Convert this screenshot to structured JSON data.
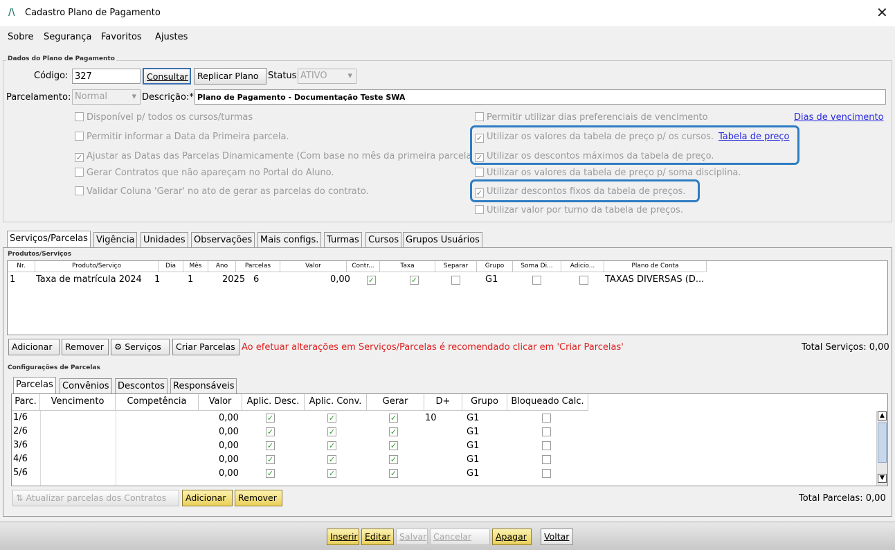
{
  "window": {
    "title": "Cadastro Plano de Pagamento",
    "logo": "/\\",
    "close": "✕"
  },
  "menu": [
    "Sobre",
    "Segurança",
    "Favoritos",
    "Ajustes"
  ],
  "plano": {
    "legend": "Dados do Plano de Pagamento",
    "codigo_label": "Código:",
    "codigo_value": "327",
    "consultar": "Consultar",
    "replicar": "Replicar Plano",
    "status_label": "Status:",
    "status_value": "ATIVO",
    "parcelamento_label": "Parcelamento:",
    "parcelamento_value": "Normal",
    "descricao_label": "Descrição:*",
    "descricao_value": "Plano de Pagamento - Documentação Teste SWA"
  },
  "options_left": [
    {
      "label": "Disponível p/ todos os cursos/turmas",
      "checked": false
    },
    {
      "label": "Permitir informar a Data da Primeira parcela.",
      "checked": false
    },
    {
      "label": "Ajustar as Datas das Parcelas Dinamicamente (Com base no mês da primeira parcela",
      "checked": true
    },
    {
      "label": "Gerar Contratos que não apareçam no Portal do Aluno.",
      "checked": false
    },
    {
      "label": "Validar Coluna 'Gerar' no ato de gerar as parcelas do contrato.",
      "checked": false
    }
  ],
  "options_right": [
    {
      "label": "Permitir utilizar dias preferenciais de vencimento",
      "checked": false
    },
    {
      "label": "Utilizar os valores da tabela de preço p/ os cursos.",
      "checked": true
    },
    {
      "label": "Utilizar os descontos máximos da tabela de preço.",
      "checked": true
    },
    {
      "label": "Utilizar os valores da tabela de preço p/ soma disciplina.",
      "checked": false
    },
    {
      "label": "Utilizar descontos fixos da tabela de preços.",
      "checked": true
    },
    {
      "label": "Utilizar valor por turno da tabela de preços.",
      "checked": false
    }
  ],
  "links": {
    "dias": "Dias de vencimento",
    "tabela": "Tabela de preço"
  },
  "tabs": [
    "Serviços/Parcelas",
    "Vigência",
    "Unidades",
    "Observações",
    "Mais configs.",
    "Turmas",
    "Cursos",
    "Grupos Usuários"
  ],
  "produtos": {
    "legend": "Produtos/Serviços",
    "headers": [
      "Nr.",
      "Produto/Serviço",
      "Dia",
      "Mês",
      "Ano",
      "Parcelas",
      "Valor",
      "Contr...",
      "Taxa",
      "Separar",
      "Grupo",
      "Soma Di...",
      "Adicio...",
      "Plano de Conta"
    ],
    "row": {
      "nr": "1",
      "produto": "Taxa de matrícula 2024",
      "dia": "1",
      "mes": "1",
      "ano": "2025",
      "parcelas": "6",
      "valor": "0,00",
      "grupo": "G1",
      "plano": "TAXAS DIVERSAS (D..."
    },
    "adicionar": "Adicionar",
    "remover": "Remover",
    "servicos": "Serviços",
    "criar": "Criar Parcelas",
    "aviso": "Ao efetuar alterações em Serviços/Parcelas é recomendado clicar em 'Criar Parcelas'",
    "total": "Total Serviços: 0,00"
  },
  "config": {
    "legend": "Configurações de Parcelas",
    "tabs": [
      "Parcelas",
      "Convênios",
      "Descontos",
      "Responsáveis"
    ],
    "headers": [
      "Parc.",
      "Vencimento",
      "Competência",
      "Valor",
      "Aplic. Desc.",
      "Aplic. Conv.",
      "Gerar",
      "D+",
      "Grupo",
      "Bloqueado Calc."
    ],
    "rows": [
      {
        "parc": "1/6",
        "valor": "0,00",
        "d": "10",
        "grupo": "G1"
      },
      {
        "parc": "2/6",
        "valor": "0,00",
        "d": "",
        "grupo": "G1"
      },
      {
        "parc": "3/6",
        "valor": "0,00",
        "d": "",
        "grupo": "G1"
      },
      {
        "parc": "4/6",
        "valor": "0,00",
        "d": "",
        "grupo": "G1"
      },
      {
        "parc": "5/6",
        "valor": "0,00",
        "d": "",
        "grupo": "G1"
      }
    ],
    "atualizar": "Atualizar parcelas dos Contratos",
    "adicionar": "Adicionar",
    "remover": "Remover",
    "total": "Total Parcelas: 0,00"
  },
  "actions": [
    "Inserir",
    "Editar",
    "Salvar",
    "Cancelar",
    "Apagar",
    "Voltar"
  ]
}
